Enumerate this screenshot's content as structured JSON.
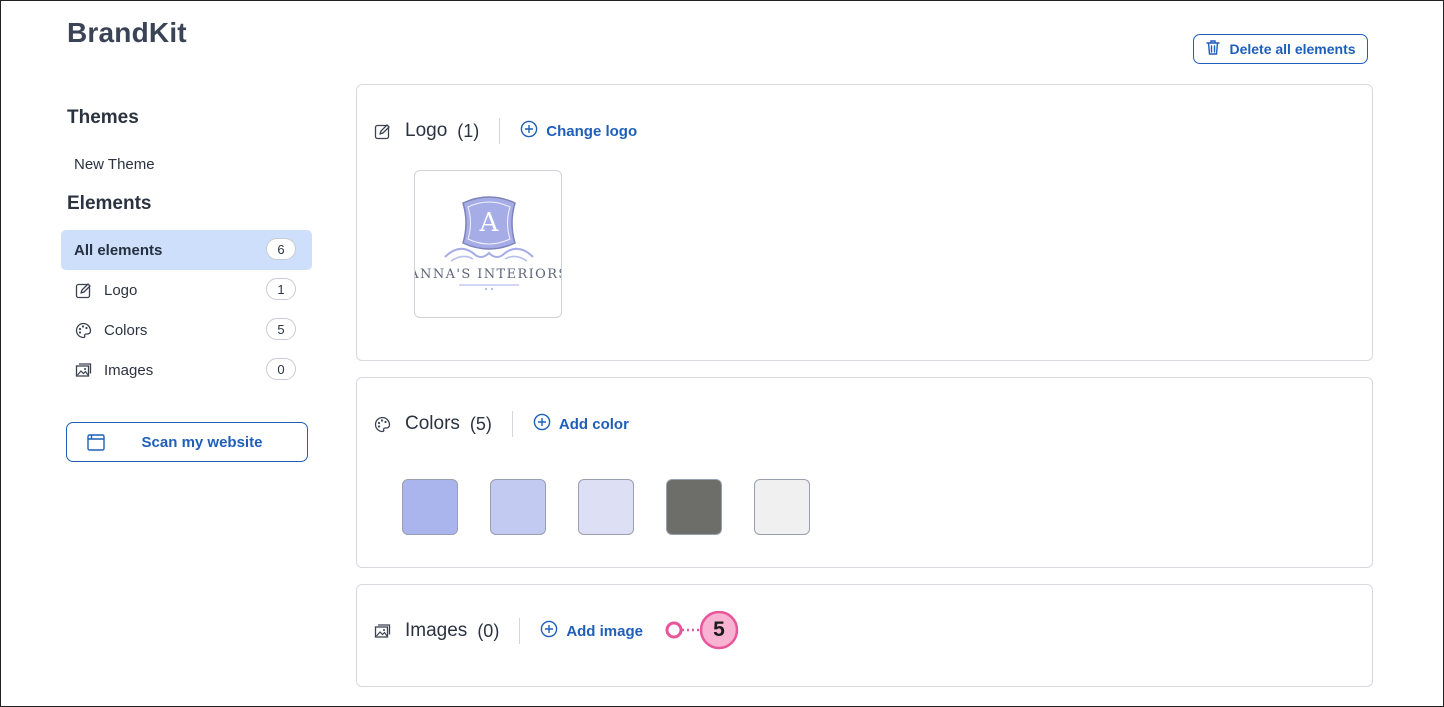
{
  "app": {
    "title": "BrandKit"
  },
  "toolbar": {
    "delete_label": "Delete all elements"
  },
  "sidebar": {
    "themes_heading": "Themes",
    "theme_item": "New Theme",
    "elements_heading": "Elements",
    "items": [
      {
        "label": "All elements",
        "count": "6",
        "icon": "none"
      },
      {
        "label": "Logo",
        "count": "1",
        "icon": "edit-icon"
      },
      {
        "label": "Colors",
        "count": "5",
        "icon": "palette-icon"
      },
      {
        "label": "Images",
        "count": "0",
        "icon": "image-icon"
      }
    ],
    "scan_label": "Scan my website"
  },
  "logo_card": {
    "title": "Logo",
    "count": "(1)",
    "action": "Change logo",
    "logo_text": "ANNA'S INTERIORS",
    "logo_letter": "A"
  },
  "colors_card": {
    "title": "Colors",
    "count": "(5)",
    "action": "Add color",
    "swatches": [
      "#aab5ee",
      "#c3caf2",
      "#dde0f4",
      "#6d6e69",
      "#f0f0f0"
    ]
  },
  "images_card": {
    "title": "Images",
    "count": "(0)",
    "action": "Add image"
  },
  "callout": {
    "number": "5",
    "color": "#e8559a",
    "fill": "#f9b3d2"
  },
  "colors": {
    "accent": "#1f5fb8",
    "active_bg": "#cddffb"
  }
}
